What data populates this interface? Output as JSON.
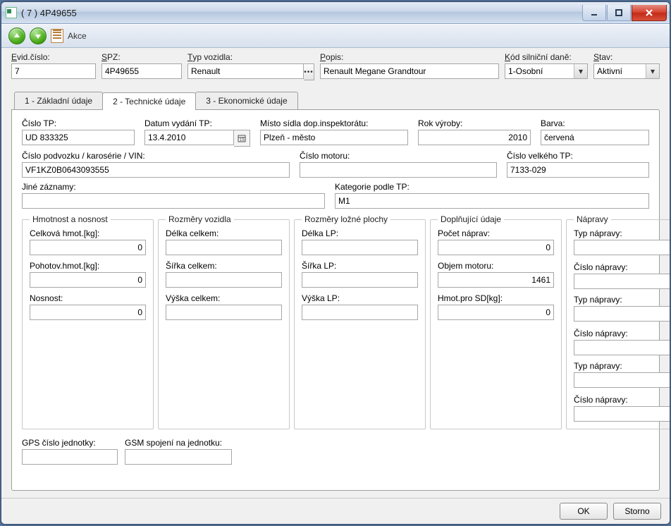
{
  "window": {
    "title": "( 7 )  4P49655"
  },
  "toolbar": {
    "actions_label": "Akce"
  },
  "top": {
    "evid_label": "Evid.číslo:",
    "evid_value": "7",
    "spz_label": "SPZ:",
    "spz_value": "4P49655",
    "typ_label": "Typ vozidla:",
    "typ_value": "Renault",
    "popis_label": "Popis:",
    "popis_value": "Renault Megane Grandtour",
    "kod_label": "Kód silniční daně:",
    "kod_value": "1-Osobní",
    "stav_label": "Stav:",
    "stav_value": "Aktivní"
  },
  "tabs": {
    "t1": "1 - Základní údaje",
    "t2": "2 - Technické údaje",
    "t3": "3 - Ekonomické údaje"
  },
  "tech": {
    "cislo_tp_label": "Číslo TP:",
    "cislo_tp": "UD 833325",
    "datum_tp_label": "Datum vydání TP:",
    "datum_tp": "13.4.2010",
    "misto_label": "Místo sídla dop.inspektorátu:",
    "misto": "Plzeň - město",
    "rok_label": "Rok výroby:",
    "rok": "2010",
    "barva_label": "Barva:",
    "barva": "červená",
    "vin_label": "Číslo podvozku / karosérie / VIN:",
    "vin": "VF1KZ0B0643093555",
    "motor_label": "Číslo motoru:",
    "motor": "",
    "velke_tp_label": "Číslo velkého TP:",
    "velke_tp": "7133-029",
    "jine_label": "Jiné záznamy:",
    "jine": "",
    "kat_tp_label": "Kategorie podle TP:",
    "kat_tp": "M1"
  },
  "groups": {
    "hmot_legend": "Hmotnost a nosnost",
    "celkova_label": "Celková hmot.[kg]:",
    "celkova": "0",
    "pohot_label": "Pohotov.hmot.[kg]:",
    "pohot": "0",
    "nosnost_label": "Nosnost:",
    "nosnost": "0",
    "rozv_legend": "Rozměry vozidla",
    "delka_c_label": "Délka celkem:",
    "delka_c": "",
    "sirka_c_label": "Šířka celkem:",
    "sirka_c": "",
    "vyska_c_label": "Výška celkem:",
    "vyska_c": "",
    "rozlp_legend": "Rozměry ložné plochy",
    "delka_lp_label": "Délka LP:",
    "delka_lp": "",
    "sirka_lp_label": "Šířka LP:",
    "sirka_lp": "",
    "vyska_lp_label": "Výška LP:",
    "vyska_lp": "",
    "dopl_legend": "Doplňující údaje",
    "pocet_naprav_label": "Počet náprav:",
    "pocet_naprav": "0",
    "objem_label": "Objem motoru:",
    "objem": "1461",
    "hmot_sd_label": "Hmot.pro SD[kg]:",
    "hmot_sd": "0",
    "napravy_legend": "Nápravy",
    "typ_napravy_label": "Typ nápravy:",
    "cislo_napravy_label": "Číslo nápravy:",
    "n1_t": "",
    "n1_c": "",
    "n2_t": "",
    "n2_c": "",
    "n3_t": "",
    "n3_c": ""
  },
  "gps": {
    "gps_label": "GPS číslo jednotky:",
    "gps": "",
    "gsm_label": "GSM spojení na jednotku:",
    "gsm": ""
  },
  "btn": {
    "ok": "OK",
    "cancel": "Storno"
  }
}
